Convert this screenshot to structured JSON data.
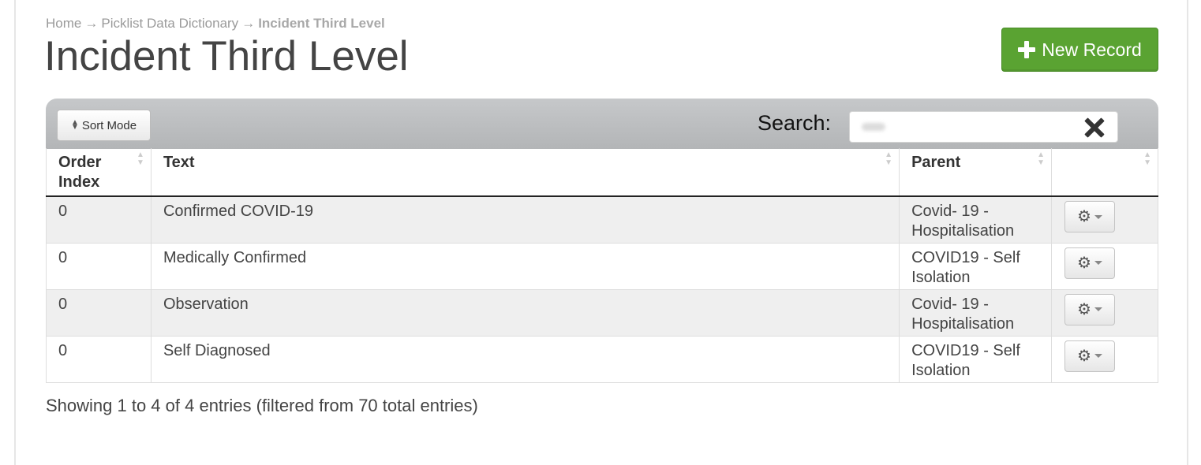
{
  "breadcrumb": {
    "home": "Home",
    "separator": "→",
    "parent": "Picklist Data Dictionary",
    "current": "Incident Third Level"
  },
  "page": {
    "title": "Incident Third Level",
    "new_record_label": "New Record"
  },
  "toolbar": {
    "sort_mode_label": "Sort Mode",
    "search_label": "Search:",
    "search_value": ""
  },
  "table": {
    "columns": [
      {
        "label": "Order\nIndex",
        "key": "order_index"
      },
      {
        "label": "Text",
        "key": "text"
      },
      {
        "label": "Parent",
        "key": "parent"
      },
      {
        "label": "",
        "key": "actions"
      }
    ],
    "rows": [
      {
        "order_index": "0",
        "text": "Confirmed COVID-19",
        "parent": "Covid- 19 - Hospitalisation"
      },
      {
        "order_index": "0",
        "text": "Medically Confirmed",
        "parent": "COVID19 - Self Isolation"
      },
      {
        "order_index": "0",
        "text": "Observation",
        "parent": "Covid- 19 - Hospitalisation"
      },
      {
        "order_index": "0",
        "text": "Self Diagnosed",
        "parent": "COVID19 - Self Isolation"
      }
    ]
  },
  "footer": {
    "info": "Showing 1 to 4 of 4 entries (filtered from 70 total entries)"
  },
  "colors": {
    "primary_button": "#5aa332",
    "toolbar": "#b9bbbd",
    "odd_row": "#efefef"
  }
}
